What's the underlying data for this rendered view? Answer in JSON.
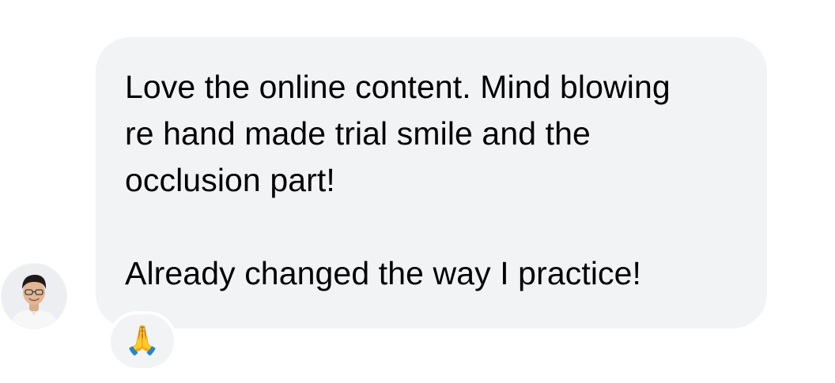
{
  "message": {
    "paragraph_1": "Love the online content. Mind blowing re hand made trial smile and the occlusion part!",
    "paragraph_2": "Already changed the way I practice!"
  },
  "reaction": {
    "emoji": "🙏",
    "icon": "folded-hands-icon"
  },
  "sender": {
    "avatar_icon": "profile-photo-avatar"
  },
  "colors": {
    "bubble_background": "#f2f3f5",
    "text": "#000000",
    "page_background": "#ffffff"
  }
}
